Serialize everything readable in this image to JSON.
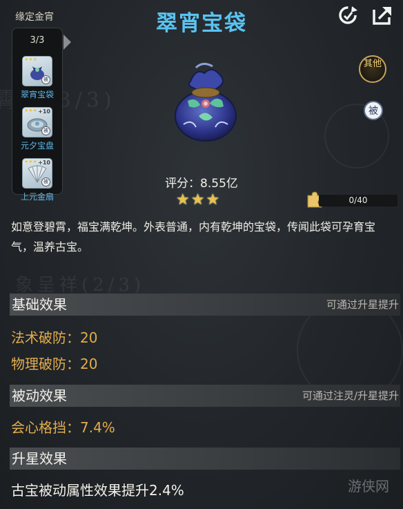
{
  "set": {
    "label": "缘定金宵",
    "count": "3/3",
    "items": [
      {
        "label": "翠宵宝袋",
        "icon": "cuixiao-bag-icon"
      },
      {
        "label": "元夕宝盘",
        "icon": "yuanxi-plate-icon",
        "tag": "+10"
      },
      {
        "label": "上元金扇",
        "icon": "shangyuan-fan-icon",
        "tag": "+10"
      }
    ]
  },
  "header": {
    "title": "翠宵宝袋"
  },
  "badges": {
    "other": "其他",
    "passive": "被"
  },
  "item": {
    "score": "评分：8.55亿",
    "stars": "★★★",
    "star_count": 3,
    "shard_progress": "0/40",
    "shard_fraction": 0.0,
    "description": "如意登碧霄，福宝满乾坤。外表普通，内有乾坤的宝袋，传闻此袋可孕育宝气，温养古宝。"
  },
  "sections": {
    "basic": {
      "title": "基础效果",
      "note": "可通过升星提升",
      "stats": [
        "法术破防：20",
        "物理破防：20"
      ]
    },
    "passive": {
      "title": "被动效果",
      "note": "可通过注灵/升星提升",
      "stats": [
        "会心格挡：7.4%"
      ]
    },
    "star_up": {
      "title": "升星效果",
      "text": "古宝被动属性效果提升2.4%"
    }
  },
  "colors": {
    "title": "#59c3f1",
    "stat": "#e3ad4e",
    "side_label": "#5fb8ea",
    "star": "#e9c24c"
  },
  "watermark": "游侠网"
}
